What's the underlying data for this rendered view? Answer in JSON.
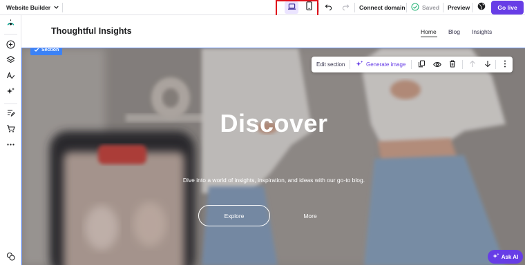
{
  "toolbar": {
    "builder_label": "Website Builder",
    "connect_domain": "Connect domain",
    "saved": "Saved",
    "preview": "Preview",
    "go_live": "Go live"
  },
  "site": {
    "logo": "Thoughtful Insights",
    "nav": [
      {
        "label": "Home",
        "active": true
      },
      {
        "label": "Blog"
      },
      {
        "label": "Insights"
      }
    ]
  },
  "section_tag": "Section",
  "floating_toolbar": {
    "edit_section": "Edit section",
    "generate_image": "Generate image"
  },
  "hero": {
    "title": "Discover",
    "subtitle": "Dive into a world of insights, inspiration, and ideas with our go-to blog.",
    "primary_button": "Explore",
    "secondary_button": "More"
  },
  "ask_ai": "Ask AI",
  "colors": {
    "accent": "#673de6",
    "highlight": "#e0101a",
    "selection": "#3b82f6"
  }
}
